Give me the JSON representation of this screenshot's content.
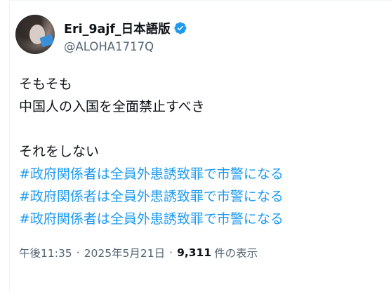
{
  "author": {
    "display_name": "Eri_9ajf_日本語版",
    "handle": "@ALOHA1717Q",
    "verified": true,
    "verified_color": "#1d9bf0",
    "avatar_icon": "profile-photo"
  },
  "tweet": {
    "lines": [
      "そもそも",
      "中国人の入国を全面禁止すべき",
      "",
      "それをしない"
    ],
    "hashtags": [
      "#政府関係者は全員外患誘致罪で市警になる",
      "#政府関係者は全員外患誘致罪で市警になる",
      "#政府関係者は全員外患誘致罪で市警になる"
    ],
    "hashtag_color": "#1d9bf0"
  },
  "meta": {
    "time": "午後11:35",
    "separator": "·",
    "date": "2025年5月21日",
    "views_count": "9,311",
    "views_label": "件の表示"
  }
}
